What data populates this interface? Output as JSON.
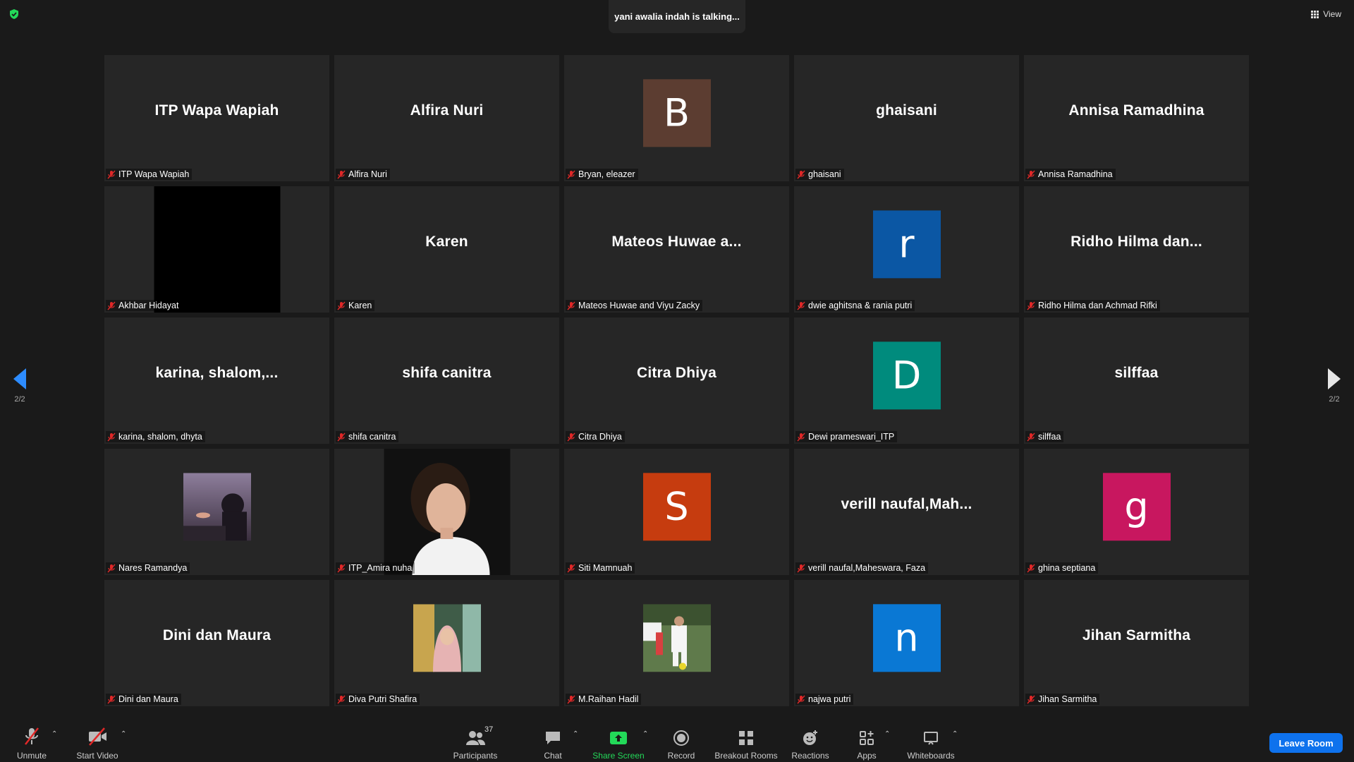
{
  "top": {
    "talking_text": "yani awalia indah is talking...",
    "view_label": "View"
  },
  "pager": {
    "left_label": "2/2",
    "right_label": "2/2"
  },
  "tiles": [
    {
      "big": "ITP Wapa Wapiah",
      "label": "ITP Wapa Wapiah"
    },
    {
      "big": "Alfira Nuri",
      "label": "Alfira Nuri"
    },
    {
      "initial": "B",
      "color": "#5c3d31",
      "label": "Bryan, eleazer"
    },
    {
      "big": "ghaisani",
      "label": "ghaisani"
    },
    {
      "big": "Annisa Ramadhina",
      "label": "Annisa Ramadhina"
    },
    {
      "label": "Akhbar Hidayat"
    },
    {
      "big": "Karen",
      "label": "Karen"
    },
    {
      "big": "Mateos Huwae a...",
      "label": "Mateos Huwae and Viyu Zacky"
    },
    {
      "initial": "r",
      "color": "#0b57a4",
      "label": "dwie aghitsna & rania putri"
    },
    {
      "big": "Ridho Hilma dan...",
      "label": "Ridho Hilma dan Achmad Rifki"
    },
    {
      "big": "karina,  shalom,...",
      "label": "karina, shalom, dhyta"
    },
    {
      "big": "shifa canitra",
      "label": "shifa canitra"
    },
    {
      "big": "Citra Dhiya",
      "label": "Citra Dhiya"
    },
    {
      "initial": "D",
      "color": "#008b7d",
      "label": "Dewi prameswari_ITP"
    },
    {
      "big": "silffaa",
      "label": "silffaa"
    },
    {
      "label": "Nares Ramandya"
    },
    {
      "label": "ITP_Amira nuha"
    },
    {
      "initial": "S",
      "color": "#c63c0f",
      "label": "Siti Mamnuah"
    },
    {
      "big": "verill  naufal,Mah...",
      "label": "verill naufal,Maheswara, Faza"
    },
    {
      "initial": "g",
      "color": "#c8175f",
      "label": "ghina septiana"
    },
    {
      "big": "Dini dan Maura",
      "label": "Dini dan Maura"
    },
    {
      "label": "Diva Putri Shafira"
    },
    {
      "label": "M.Raihan Hadil"
    },
    {
      "initial": "n",
      "color": "#0a78d4",
      "label": "najwa putri"
    },
    {
      "big": "Jihan Sarmitha",
      "label": "Jihan Sarmitha"
    }
  ],
  "toolbar": {
    "unmute": "Unmute",
    "start_video": "Start Video",
    "participants": "Participants",
    "participants_count": "37",
    "chat": "Chat",
    "share_screen": "Share Screen",
    "record": "Record",
    "breakout_rooms": "Breakout Rooms",
    "reactions": "Reactions",
    "apps": "Apps",
    "whiteboards": "Whiteboards",
    "leave_room": "Leave Room"
  }
}
